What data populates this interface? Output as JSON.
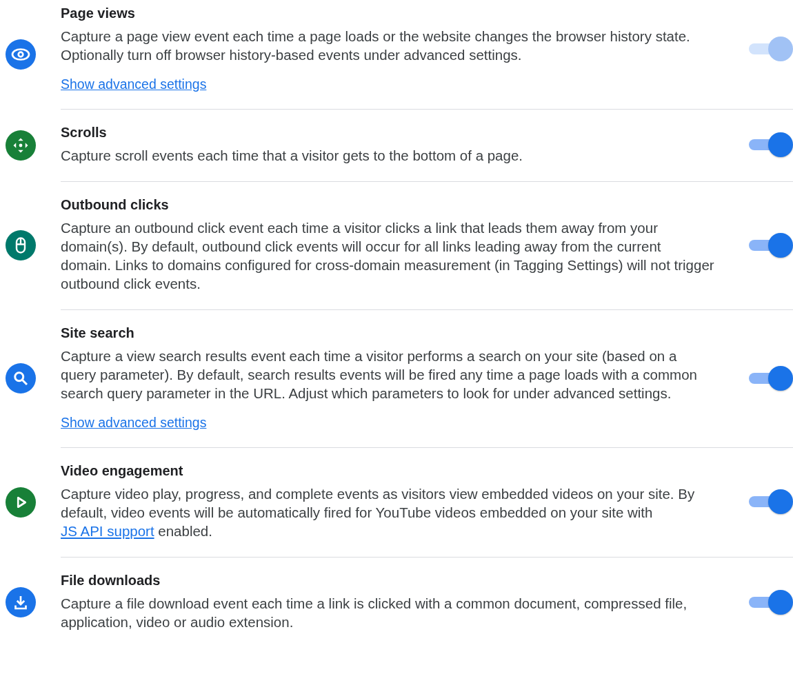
{
  "events": [
    {
      "kind": "eye",
      "color": "#1a73e8",
      "title": "Page views",
      "description": [
        {
          "kind": "text",
          "text": "Capture a page view event each time a page loads or the website changes the browser history state. Optionally turn off browser history-based events under advanced settings."
        }
      ],
      "advanced_link": "Show advanced settings",
      "on": true,
      "disabled": true
    },
    {
      "kind": "scroll",
      "color": "#188038",
      "title": "Scrolls",
      "description": [
        {
          "kind": "text",
          "text": "Capture scroll events each time that a visitor gets to the bottom of a page."
        }
      ],
      "on": true,
      "disabled": false
    },
    {
      "kind": "mouse",
      "color": "#00796b",
      "title": "Outbound clicks",
      "description": [
        {
          "kind": "text",
          "text": "Capture an outbound click event each time a visitor clicks a link that leads them away from your domain(s). By default, outbound click events will occur for all links leading away from the current domain. Links to domains configured for cross-domain measurement (in Tagging Settings) will not trigger outbound click events."
        }
      ],
      "on": true,
      "disabled": false
    },
    {
      "kind": "search",
      "color": "#1a73e8",
      "title": "Site search",
      "description": [
        {
          "kind": "text",
          "text": "Capture a view search results event each time a visitor performs a search on your site (based on a query parameter). By default, search results events will be fired any time a page loads with a common search query parameter in the URL. Adjust which parameters to look for under advanced settings."
        }
      ],
      "advanced_link": "Show advanced settings",
      "on": true,
      "disabled": false
    },
    {
      "kind": "play",
      "color": "#188038",
      "title": "Video engagement",
      "description": [
        {
          "kind": "text",
          "text": "Capture video play, progress, and complete events as visitors view embedded videos on your site. By default, video events will be automatically fired for YouTube videos embedded on your site with "
        },
        {
          "kind": "link",
          "text": "JS API support"
        },
        {
          "kind": "text",
          "text": " enabled."
        }
      ],
      "on": true,
      "disabled": false
    },
    {
      "kind": "download",
      "color": "#1a73e8",
      "title": "File downloads",
      "description": [
        {
          "kind": "text",
          "text": "Capture a file download event each time a link is clicked with a common document, compressed file, application, video or audio extension."
        }
      ],
      "on": true,
      "disabled": false
    }
  ]
}
